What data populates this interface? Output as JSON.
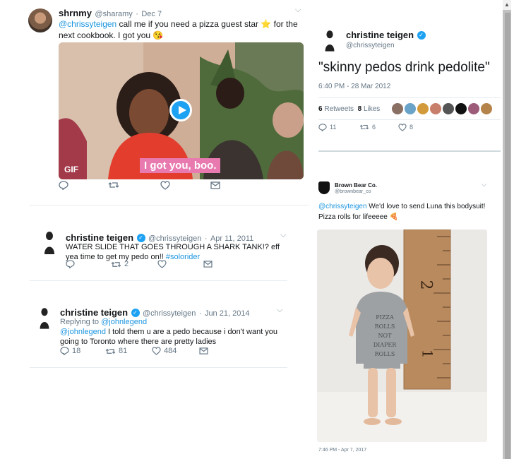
{
  "tweet1": {
    "name": "shrnmy",
    "handle": "@sharamy",
    "dot": "·",
    "date": "Dec 7",
    "mention": "@chrissyteigen",
    "text_a": " call me if you need a pizza guest star ",
    "emoji1": "⭐",
    "text_b": " for the next cookbook. I got you ",
    "emoji2": "😘",
    "gif_badge": "GIF",
    "caption": "I got you, boo."
  },
  "tweet2": {
    "name": "christine teigen",
    "handle": "@chrissyteigen",
    "dot": "·",
    "date": "Apr 11, 2011",
    "text": "WATER SLIDE THAT GOES THROUGH A SHARK TANK!? eff yea time to get my pedo on!! ",
    "hashtag": "#solorider",
    "retweets": "2"
  },
  "tweet3": {
    "name": "christine teigen",
    "handle": "@chrissyteigen",
    "dot": "·",
    "date": "Jun 21, 2014",
    "replying_label": "Replying to ",
    "replying_to": "@johnlegend",
    "mention": "@johnlegend",
    "text": " I told them u are a pedo because i don't want you going to Toronto where there are pretty ladies",
    "replies": "18",
    "retweets": "81",
    "likes": "484"
  },
  "tweet4": {
    "name": "christine teigen",
    "handle": "@chrissyteigen",
    "text": "\"skinny pedos drink pedolite\"",
    "timestamp": "6:40 PM - 28 Mar 2012",
    "retweets_count": "6",
    "retweets_label": "Retweets",
    "likes_count": "8",
    "likes_label": "Likes",
    "replies": "11",
    "retweets": "6",
    "likes": "8"
  },
  "tweet5": {
    "name": "Brown Bear Co.",
    "handle": "@brownbear_co",
    "mention": "@chrissyteigen",
    "text_a": " We'd love to send Luna this bodysuit!",
    "text_b": "Pizza rolls for lifeeeee ",
    "emoji": "🍕",
    "ruler_numbers": [
      "2",
      "1"
    ],
    "onesie_text": [
      "PIZZA ROLLS",
      "NOT",
      "DIAPER ROLLS"
    ],
    "timestamp": "7:46 PM - Apr 7, 2017"
  },
  "colors": {
    "link": "#1b95e0",
    "verified": "#1da1f2",
    "muted": "#657786",
    "caption_bg": "#e87ab0"
  }
}
